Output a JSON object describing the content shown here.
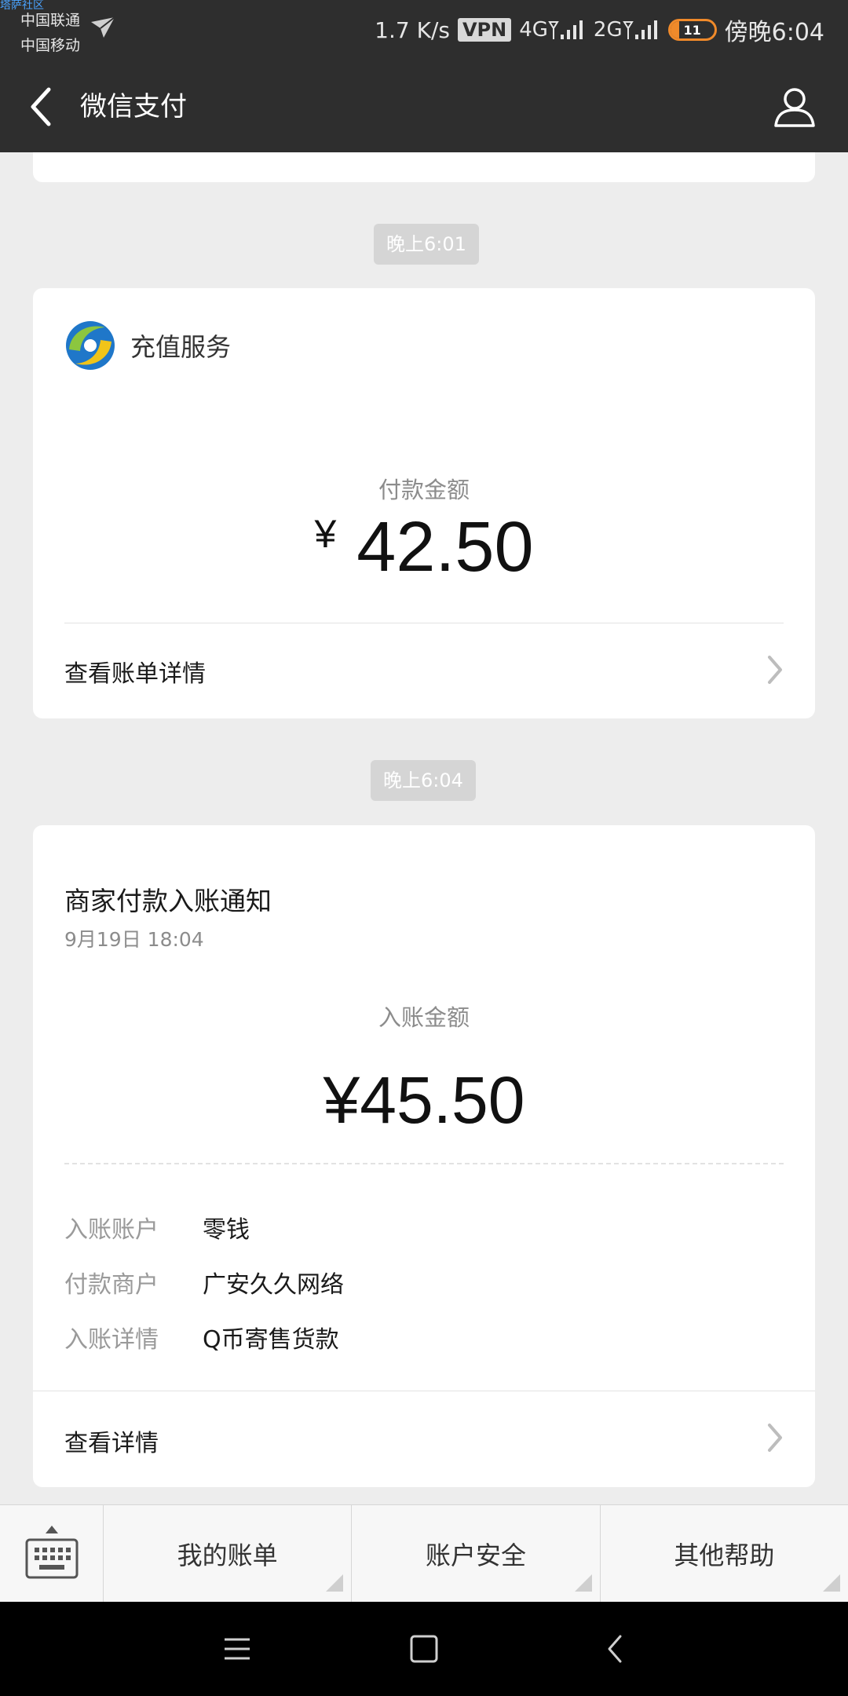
{
  "status": {
    "watermark": "塔萨社区",
    "carrier1": "中国联通",
    "carrier2": "中国移动",
    "speed": "1.7 K/s",
    "vpn": "VPN",
    "net1": "4G",
    "net2": "2G",
    "battery": "11",
    "battery_level": 0.2,
    "time": "傍晚6:04",
    "accent": "#f08a2a"
  },
  "header": {
    "title": "微信支付"
  },
  "messages": [
    {
      "time": "晚上6:01",
      "service": "充值服务",
      "amount_label": "付款金额",
      "currency": "¥",
      "amount": "42.50",
      "link": "查看账单详情"
    },
    {
      "time": "晚上6:04",
      "title": "商家付款入账通知",
      "date": "9月19日  18:04",
      "amount_label": "入账金额",
      "amount": "¥45.50",
      "details": [
        {
          "key": "入账账户",
          "value": "零钱"
        },
        {
          "key": "付款商户",
          "value": "广安久久网络"
        },
        {
          "key": "入账详情",
          "value": "Q币寄售货款"
        }
      ],
      "link": "查看详情"
    }
  ],
  "menu": {
    "items": [
      "我的账单",
      "账户安全",
      "其他帮助"
    ]
  },
  "icons": [
    "airplane-icon",
    "back-icon",
    "person-icon",
    "logo-icon",
    "chevron-right-icon",
    "keyboard-icon",
    "menu-icon",
    "home-icon",
    "nav-back-icon"
  ]
}
